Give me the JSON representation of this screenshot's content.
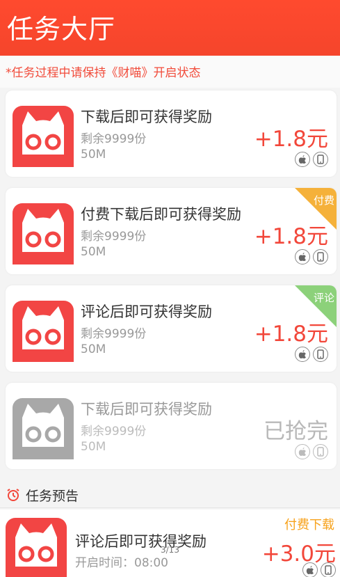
{
  "header": {
    "title": "任务大厅"
  },
  "notice": "*任务过程中请保持《财喵》开启状态",
  "tasks": [
    {
      "title": "下载后即可获得奖励",
      "remaining": "剩余9999份",
      "size": "50M",
      "reward": "+1.8元",
      "corner": ""
    },
    {
      "title": "付费下载后即可获得奖励",
      "remaining": "剩余9999份",
      "size": "50M",
      "reward": "+1.8元",
      "corner": "付费"
    },
    {
      "title": "评论后即可获得奖励",
      "remaining": "剩余9999份",
      "size": "50M",
      "reward": "+1.8元",
      "corner": "评论"
    },
    {
      "title": "下载后即可获得奖励",
      "remaining": "剩余9999份",
      "size": "50M",
      "reward": "已抢完",
      "corner": ""
    }
  ],
  "preview_section": {
    "title": "任务预告",
    "item": {
      "title": "评论后即可获得奖励",
      "start_time": "开启时间：08:00",
      "tag": "付费下载",
      "reward": "+3.0元"
    }
  },
  "page_indicator": "3/13",
  "colors": {
    "header": "#f5452c",
    "accent": "#f2473a",
    "paid_corner": "#f5b13a",
    "comment_corner": "#8cd17a",
    "preview_tag": "#f7a21b",
    "icon_red": "#f24544",
    "icon_gray": "#a8a8a8"
  },
  "icons": [
    "cat-app-icon",
    "apple-icon",
    "phone-icon",
    "alarm-clock-icon"
  ]
}
